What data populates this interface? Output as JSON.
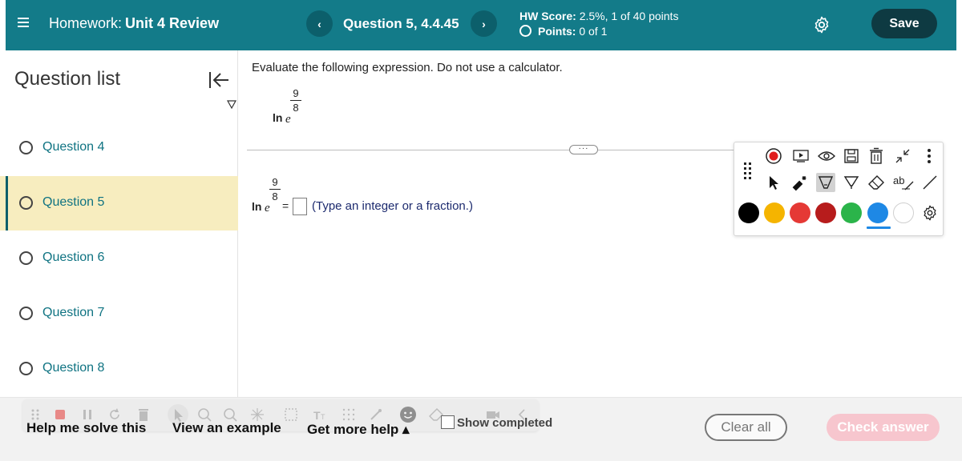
{
  "header": {
    "homework_prefix": "Homework:",
    "homework_name": "Unit 4 Review",
    "question_label": "Question 5, 4.4.45",
    "prev_glyph": "‹",
    "next_glyph": "›",
    "hw_score_label": "HW Score:",
    "hw_score_value": "2.5%, 1 of 40 points",
    "points_label": "Points:",
    "points_value": "0 of 1",
    "save_label": "Save",
    "bg_color": "#137b89"
  },
  "sidebar": {
    "title": "Question list",
    "items": [
      {
        "label": "Question 4",
        "active": false
      },
      {
        "label": "Question 5",
        "active": true
      },
      {
        "label": "Question 6",
        "active": false
      },
      {
        "label": "Question 7",
        "active": false
      },
      {
        "label": "Question 8",
        "active": false
      }
    ]
  },
  "question": {
    "instructions": "Evaluate the following expression. Do not use a calculator.",
    "fn": "ln",
    "base": "e",
    "exp_num": "9",
    "exp_den": "8",
    "equals": "=",
    "answer_value": "",
    "hint": "(Type an integer or a fraction.)",
    "divider_handle": "···"
  },
  "annotation_toolbar": {
    "tools_row1": [
      "record-icon",
      "play-video-icon",
      "eye-icon",
      "save-disk-icon",
      "trash-icon",
      "collapse-arrows-icon",
      "more-vertical-icon"
    ],
    "tools_row2": [
      "pointer-icon",
      "laser-pointer-icon",
      "highlighter-icon",
      "pen-icon",
      "eraser-icon",
      "text-tool-icon",
      "line-tool-icon"
    ],
    "text_tool_label": "ab",
    "colors": [
      "#000000",
      "#f5b400",
      "#e53935",
      "#b71c1c",
      "#2bb44a",
      "#1e88e5",
      "#ffffff"
    ],
    "selected_color": "#1e88e5"
  },
  "bottom": {
    "help_me_solve": "Help me solve this",
    "view_example": "View an example",
    "get_more_help": "Get more help ▴",
    "show_completed": "Show completed",
    "clear_all": "Clear all",
    "check_answer": "Check answer"
  }
}
